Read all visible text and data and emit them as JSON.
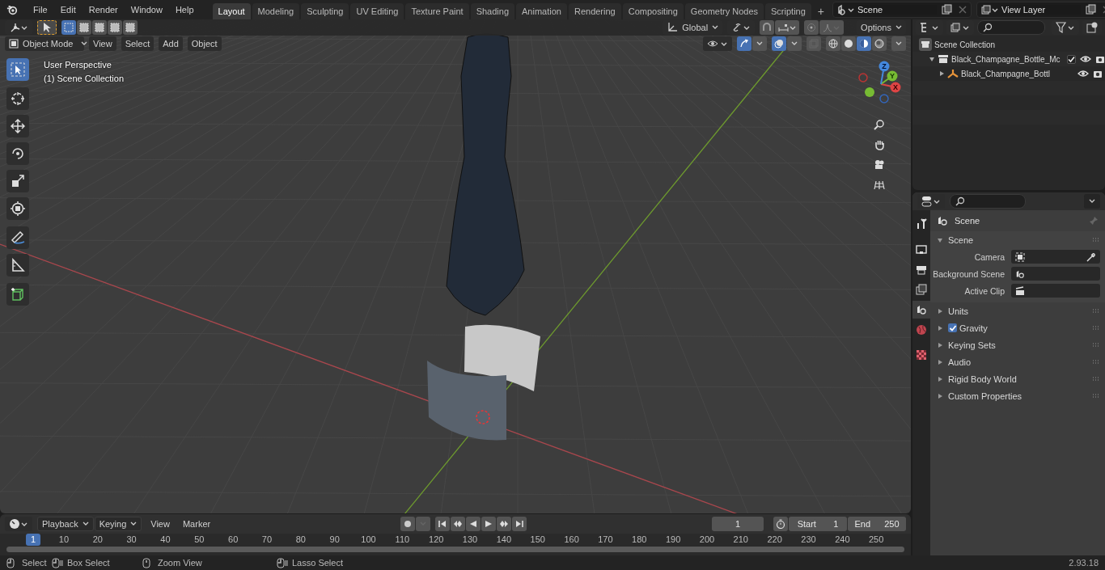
{
  "menu_bar": {
    "menus": [
      "File",
      "Edit",
      "Render",
      "Window",
      "Help"
    ]
  },
  "workspace_tabs": [
    {
      "label": "Layout",
      "selected": true
    },
    {
      "label": "Modeling",
      "selected": false
    },
    {
      "label": "Sculpting",
      "selected": false
    },
    {
      "label": "UV Editing",
      "selected": false
    },
    {
      "label": "Texture Paint",
      "selected": false
    },
    {
      "label": "Shading",
      "selected": false
    },
    {
      "label": "Animation",
      "selected": false
    },
    {
      "label": "Rendering",
      "selected": false
    },
    {
      "label": "Compositing",
      "selected": false
    },
    {
      "label": "Geometry Nodes",
      "selected": false
    },
    {
      "label": "Scripting",
      "selected": false
    }
  ],
  "add_tab": "+",
  "scene_field": {
    "value": "Scene"
  },
  "view_layer_field": {
    "value": "View Layer"
  },
  "viewport": {
    "select_modes": [
      {
        "selected": true
      },
      {
        "selected": false
      },
      {
        "selected": false
      },
      {
        "selected": false
      },
      {
        "selected": false
      }
    ],
    "orientation": "Global",
    "options": "Options",
    "mode": "Object Mode",
    "menus": [
      "View",
      "Select",
      "Add",
      "Object"
    ],
    "gizmos_on": true,
    "overlays_on": true,
    "shading": [
      {
        "kind": "wireframe",
        "selected": false
      },
      {
        "kind": "solid",
        "selected": false
      },
      {
        "kind": "material",
        "selected": true
      },
      {
        "kind": "rendered",
        "selected": false
      }
    ],
    "overlay_text": [
      "User Perspective",
      "(1) Scene Collection"
    ],
    "tools": [
      {
        "kind": "select",
        "selected": true
      },
      {
        "kind": "cursor",
        "selected": false
      },
      {
        "kind": "move",
        "selected": false
      },
      {
        "kind": "rotate",
        "selected": false
      },
      {
        "kind": "scale",
        "selected": false
      },
      {
        "kind": "transform",
        "selected": false
      },
      {
        "kind": "annotate",
        "selected": false
      },
      {
        "kind": "measure",
        "selected": false
      },
      {
        "kind": "add-cube",
        "selected": false
      }
    ],
    "gizmo_axes": [
      "Z",
      "Y",
      "X"
    ]
  },
  "outliner": {
    "items": [
      {
        "label": "Scene Collection",
        "kind": "scene-collection",
        "children": [
          {
            "label": "Black_Champagne_Bottle_Mc",
            "kind": "collection",
            "expanded": true,
            "checked": true,
            "children": [
              {
                "label": "Black_Champagne_Bottl",
                "kind": "object",
                "expanded": false
              }
            ]
          }
        ]
      }
    ]
  },
  "properties": {
    "tabs": [
      {
        "kind": "tool",
        "selected": false
      },
      {
        "kind": "render",
        "selected": false
      },
      {
        "kind": "output",
        "selected": false
      },
      {
        "kind": "view-layer",
        "selected": false
      },
      {
        "kind": "scene",
        "selected": true
      },
      {
        "kind": "world",
        "selected": false
      },
      {
        "kind": "texture",
        "selected": false
      }
    ],
    "context": "Scene",
    "panels": [
      {
        "label": "Scene",
        "kind": "plain",
        "expanded": true,
        "fields": [
          {
            "label": "Camera",
            "kind": "camera"
          },
          {
            "label": "Background Scene",
            "kind": "scene"
          },
          {
            "label": "Active Clip",
            "kind": "clip"
          }
        ]
      },
      {
        "label": "Units",
        "kind": "plain",
        "expanded": false
      },
      {
        "label": "Gravity",
        "kind": "checkbox",
        "checked": true,
        "expanded": false
      },
      {
        "label": "Keying Sets",
        "kind": "plain",
        "expanded": false
      },
      {
        "label": "Audio",
        "kind": "plain",
        "expanded": false
      },
      {
        "label": "Rigid Body World",
        "kind": "plain",
        "expanded": false
      },
      {
        "label": "Custom Properties",
        "kind": "plain",
        "expanded": false
      }
    ]
  },
  "timeline": {
    "menus": [
      "Playback",
      "Keying"
    ],
    "plain_menus": [
      "View",
      "Marker"
    ],
    "controls": [
      {
        "kind": "jump-start"
      },
      {
        "kind": "prev-key"
      },
      {
        "kind": "play-reverse"
      },
      {
        "kind": "play"
      },
      {
        "kind": "next-key"
      },
      {
        "kind": "jump-end"
      }
    ],
    "current_frame": "1",
    "start_label": "Start",
    "start": "1",
    "end_label": "End",
    "end": "250",
    "marker": "1",
    "ticks": [
      "10",
      "20",
      "30",
      "40",
      "50",
      "60",
      "70",
      "80",
      "90",
      "100",
      "110",
      "120",
      "130",
      "140",
      "150",
      "160",
      "170",
      "180",
      "190",
      "200",
      "210",
      "220",
      "230",
      "240",
      "250"
    ]
  },
  "status_bar": {
    "hints": [
      {
        "kind": "click",
        "label": "Select"
      },
      {
        "kind": "drag",
        "label": "Box Select"
      },
      {
        "kind": "middle",
        "label": "Zoom View"
      },
      {
        "kind": "drag",
        "label": "Lasso Select"
      }
    ],
    "version": "2.93.18"
  }
}
